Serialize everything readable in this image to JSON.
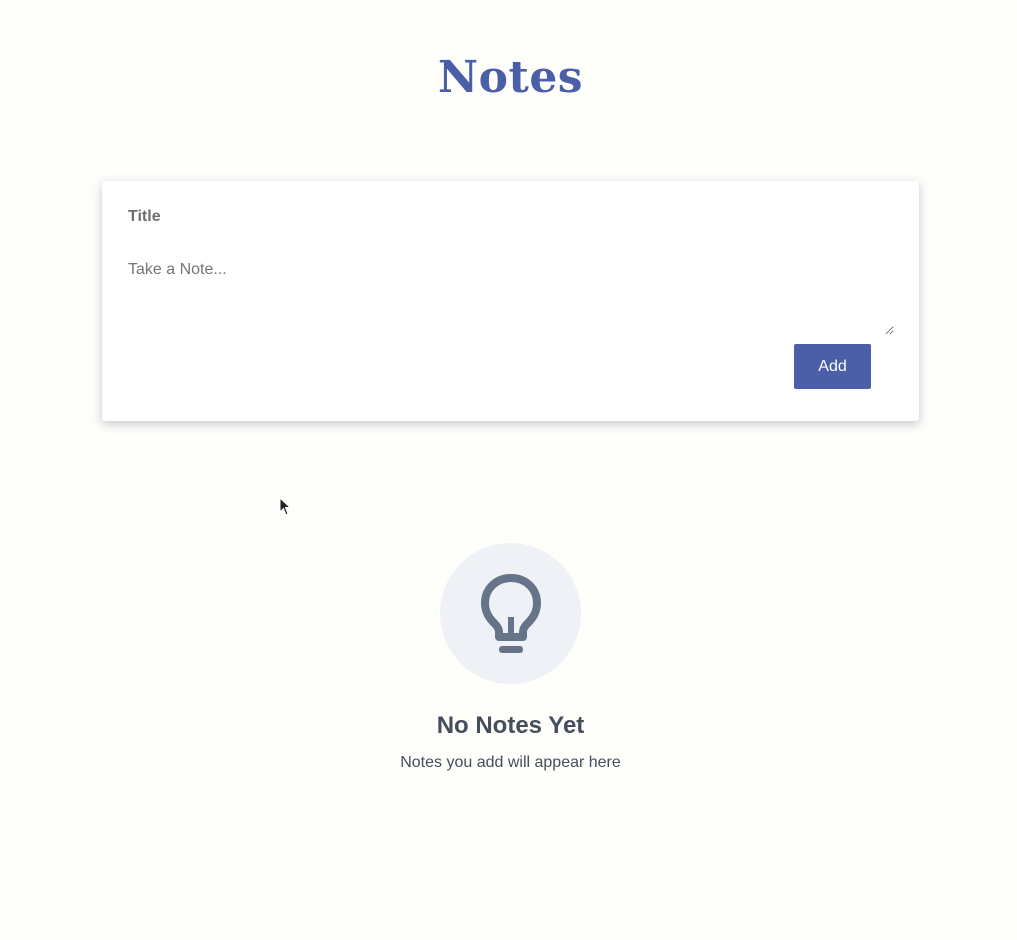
{
  "header": {
    "title": "Notes"
  },
  "form": {
    "title_placeholder": "Title",
    "title_value": "",
    "note_placeholder": "Take a Note...",
    "note_value": "",
    "add_label": "Add"
  },
  "empty_state": {
    "icon": "lightbulb-icon",
    "heading": "No Notes Yet",
    "subtext": "Notes you add will appear here"
  },
  "colors": {
    "accent": "#4a5fa8",
    "background": "#fefefb",
    "icon": "#667389",
    "icon_bg": "#eef1f6",
    "text": "#454e5c"
  }
}
